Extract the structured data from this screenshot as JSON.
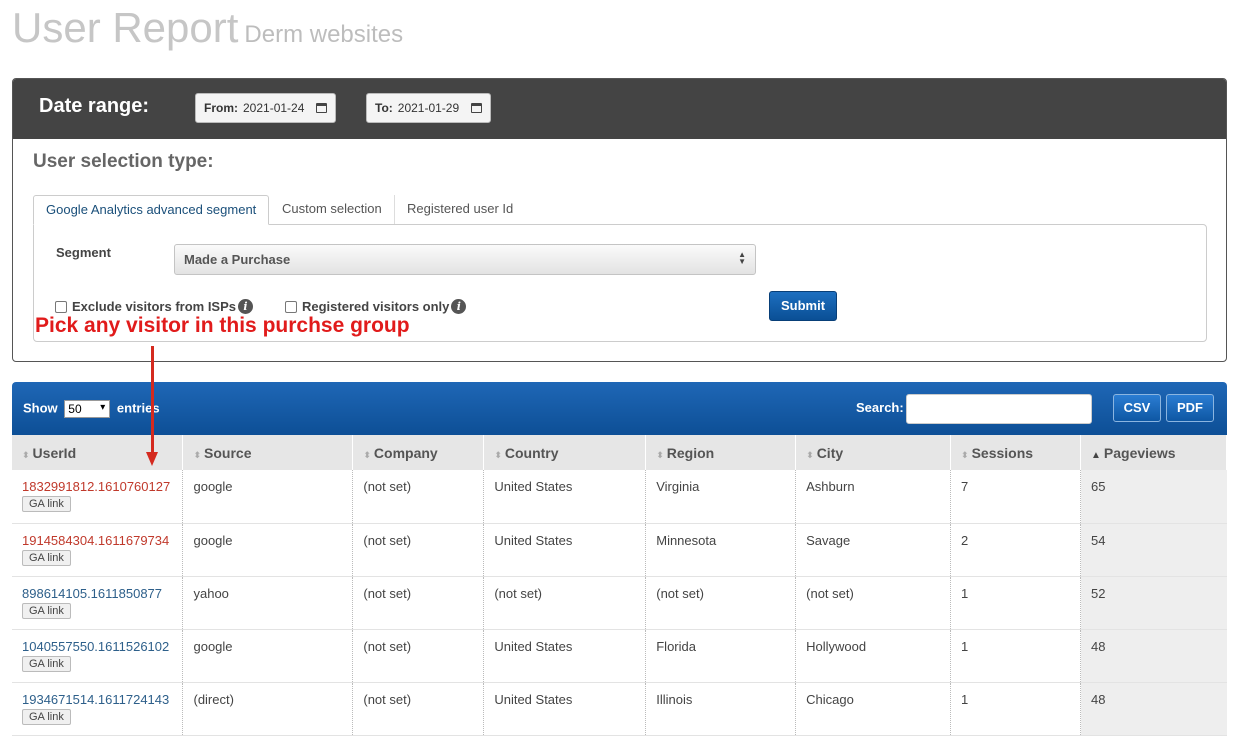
{
  "page": {
    "title": "User Report",
    "subtitle": "Derm websites"
  },
  "date_range": {
    "label": "Date range:",
    "from_label": "From:",
    "from_value": "2021-01-24",
    "to_label": "To:",
    "to_value": "2021-01-29"
  },
  "selection": {
    "heading": "User selection type:",
    "tabs": [
      {
        "label": "Google Analytics advanced segment",
        "active": true
      },
      {
        "label": "Custom selection",
        "active": false
      },
      {
        "label": "Registered user Id",
        "active": false
      }
    ],
    "segment_label": "Segment",
    "segment_value": "Made a Purchase",
    "exclude_isps_label": "Exclude visitors from ISPs",
    "registered_only_label": "Registered visitors only",
    "submit_label": "Submit"
  },
  "annotation": {
    "text": "Pick any visitor in this purchse group",
    "color": "#e11b1b"
  },
  "table_controls": {
    "show_label": "Show",
    "entries_value": "50",
    "entries_label": "entries",
    "search_label": "Search:",
    "csv_label": "CSV",
    "pdf_label": "PDF"
  },
  "table": {
    "columns": [
      "UserId",
      "Source",
      "Company",
      "Country",
      "Region",
      "City",
      "Sessions",
      "Pageviews"
    ],
    "sorted_column": "Pageviews",
    "ga_link_label": "GA link",
    "rows": [
      {
        "userid": "1832991812.1610760127",
        "source": "google",
        "company": "(not set)",
        "country": "United States",
        "region": "Virginia",
        "city": "Ashburn",
        "sessions": "7",
        "pageviews": "65"
      },
      {
        "userid": "1914584304.1611679734",
        "source": "google",
        "company": "(not set)",
        "country": "United States",
        "region": "Minnesota",
        "city": "Savage",
        "sessions": "2",
        "pageviews": "54"
      },
      {
        "userid": "898614105.1611850877",
        "source": "yahoo",
        "company": "(not set)",
        "country": "(not set)",
        "region": "(not set)",
        "city": "(not set)",
        "sessions": "1",
        "pageviews": "52"
      },
      {
        "userid": "1040557550.1611526102",
        "source": "google",
        "company": "(not set)",
        "country": "United States",
        "region": "Florida",
        "city": "Hollywood",
        "sessions": "1",
        "pageviews": "48"
      },
      {
        "userid": "1934671514.1611724143",
        "source": "(direct)",
        "company": "(not set)",
        "country": "United States",
        "region": "Illinois",
        "city": "Chicago",
        "sessions": "1",
        "pageviews": "48"
      }
    ]
  },
  "icons": {
    "calendar": "calendar-icon",
    "info": "info-icon",
    "sort": "sort-icon"
  }
}
